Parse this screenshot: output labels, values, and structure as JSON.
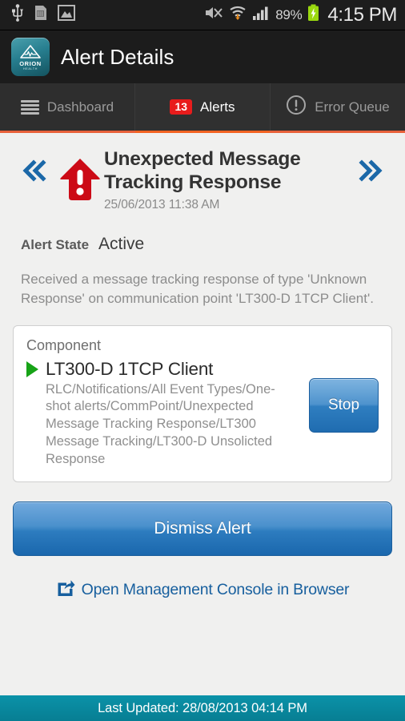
{
  "statusbar": {
    "icons_left": [
      "usb-icon",
      "sd-card-icon",
      "gallery-icon"
    ],
    "icons_right": [
      "mute-icon",
      "wifi-download-icon",
      "signal-icon"
    ],
    "battery_percent": "89%",
    "battery_icon": "battery-charging-icon",
    "clock": "4:15 PM"
  },
  "header": {
    "logo_name": "orion-health-logo",
    "logo_word": "ORION",
    "logo_sub": "HEALTH",
    "title": "Alert Details"
  },
  "tabs": [
    {
      "label": "Dashboard",
      "icon": "dashboard-icon",
      "badge": "",
      "active": false
    },
    {
      "label": "Alerts",
      "icon": "",
      "badge": "13",
      "active": true
    },
    {
      "label": "Error Queue",
      "icon": "error-circle-icon",
      "badge": "",
      "active": false
    }
  ],
  "alert": {
    "prev_icon": "chevron-double-left-icon",
    "next_icon": "chevron-double-right-icon",
    "severity_icon": "alert-exclamation-icon",
    "title": "Unexpected Message Tracking Response",
    "timestamp": "25/06/2013 11:38 AM",
    "state_label": "Alert State",
    "state_value": "Active",
    "description": "Received a message tracking response of type 'Unknown Response' on communication point 'LT300-D 1TCP Client'."
  },
  "component": {
    "card_label": "Component",
    "status_icon": "play-running-icon",
    "name": "LT300-D 1TCP Client",
    "path": "RLC/Notifications/All Event Types/One-shot alerts/CommPoint/Unexpected Message Tracking Response/LT300 Message Tracking/LT300-D Unsolicted Response",
    "stop_label": "Stop"
  },
  "actions": {
    "dismiss_label": "Dismiss Alert",
    "console_link_icon": "external-link-icon",
    "console_link_label": "Open Management Console in Browser"
  },
  "footer": {
    "text": "Last Updated: 28/08/2013 04:14 PM"
  },
  "colors": {
    "accent_orange": "#f26322",
    "badge_red": "#e81c1c",
    "alert_red": "#cc0a16",
    "link_blue": "#175f9e",
    "footer_teal": "#077e93",
    "running_green": "#17a317"
  }
}
